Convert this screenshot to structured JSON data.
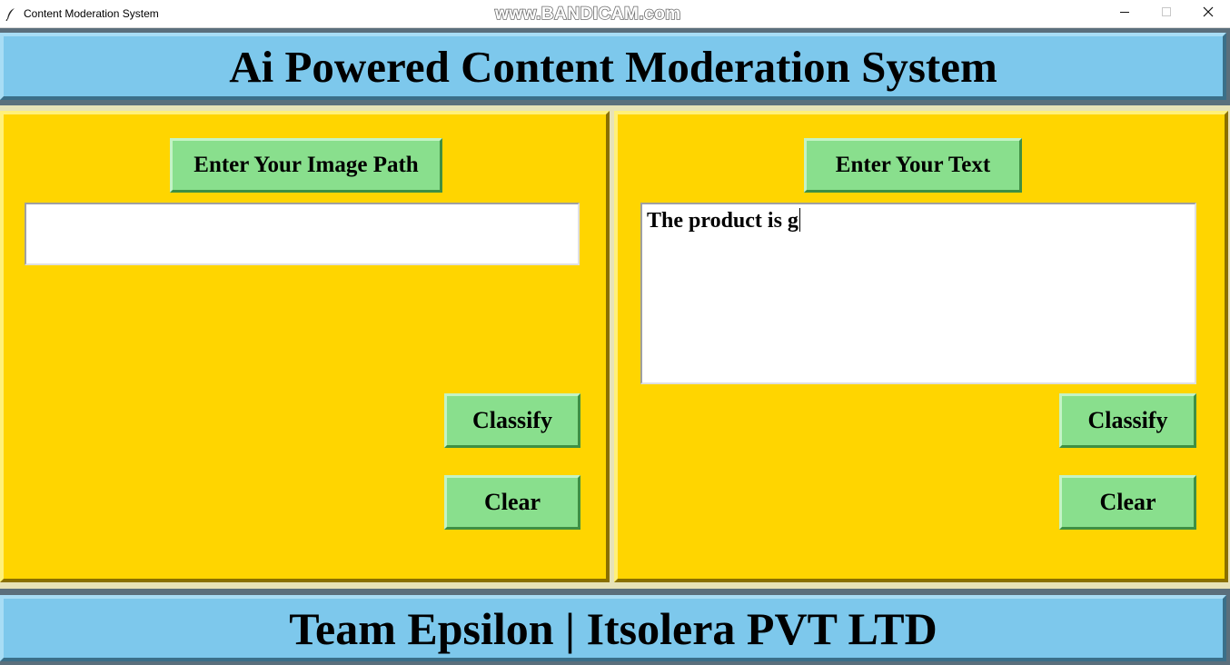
{
  "window": {
    "title": "Content Moderation System",
    "watermark": "www.BANDICAM.com",
    "icons": {
      "app": "feather-icon",
      "minimize": "minimize-icon",
      "maximize": "maximize-icon",
      "close": "close-icon"
    }
  },
  "header": {
    "title": "Ai Powered Content Moderation System"
  },
  "image_panel": {
    "label": "Enter Your Image Path",
    "input_value": "",
    "classify_label": "Classify",
    "clear_label": "Clear"
  },
  "text_panel": {
    "label": "Enter Your Text",
    "text_value": "The product is g",
    "classify_label": "Classify",
    "clear_label": "Clear"
  },
  "footer": {
    "text": "Team Epsilon | Itsolera PVT LTD"
  },
  "colors": {
    "header_bg": "#7dc8ec",
    "panel_bg": "#ffd500",
    "button_bg": "#89df8d",
    "window_bg": "#5b6f7c"
  }
}
